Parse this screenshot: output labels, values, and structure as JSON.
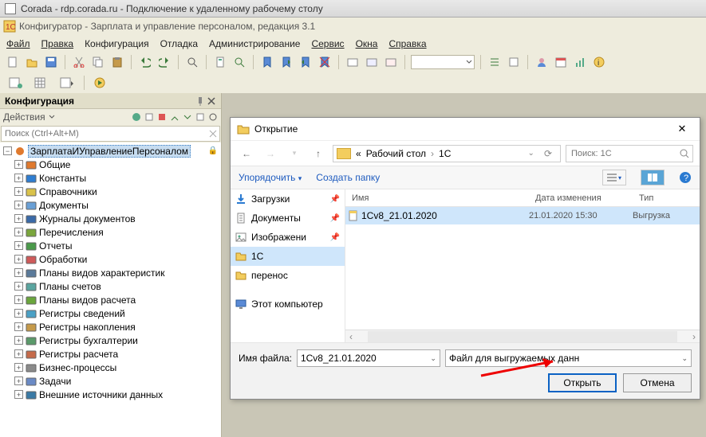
{
  "remote_title": "Corada - rdp.corada.ru - Подключение к удаленному рабочему столу",
  "app_title": "Конфигуратор - Зарплата и управление персоналом, редакция 3.1",
  "menu": [
    "Файл",
    "Правка",
    "Конфигурация",
    "Отладка",
    "Администрирование",
    "Сервис",
    "Окна",
    "Справка"
  ],
  "sidebar": {
    "title": "Конфигурация",
    "actions_label": "Действия",
    "search_placeholder": "Поиск (Ctrl+Alt+M)",
    "root": "ЗарплатаИУправлениеПерсоналом",
    "items": [
      {
        "label": "Общие",
        "color": "#e07a2e"
      },
      {
        "label": "Константы",
        "color": "#2e7dd1"
      },
      {
        "label": "Справочники",
        "color": "#d9c24a"
      },
      {
        "label": "Документы",
        "color": "#6aa0d6"
      },
      {
        "label": "Журналы документов",
        "color": "#3a6aa8"
      },
      {
        "label": "Перечисления",
        "color": "#7aa63c"
      },
      {
        "label": "Отчеты",
        "color": "#4a9a4a"
      },
      {
        "label": "Обработки",
        "color": "#cf5a5a"
      },
      {
        "label": "Планы видов характеристик",
        "color": "#5a7a9a"
      },
      {
        "label": "Планы счетов",
        "color": "#5aa5a0"
      },
      {
        "label": "Планы видов расчета",
        "color": "#6aa63c"
      },
      {
        "label": "Регистры сведений",
        "color": "#4aa0c5"
      },
      {
        "label": "Регистры накопления",
        "color": "#c59a4a"
      },
      {
        "label": "Регистры бухгалтерии",
        "color": "#5a9a6a"
      },
      {
        "label": "Регистры расчета",
        "color": "#c56a4a"
      },
      {
        "label": "Бизнес-процессы",
        "color": "#8a8a8a"
      },
      {
        "label": "Задачи",
        "color": "#6a8ac5"
      },
      {
        "label": "Внешние источники данных",
        "color": "#3a7aa5"
      }
    ]
  },
  "dialog": {
    "title": "Открытие",
    "breadcrumb_prefix": "«",
    "breadcrumb": [
      "Рабочий стол",
      "1C"
    ],
    "search_placeholder": "Поиск: 1C",
    "toolbar": {
      "organize": "Упорядочить",
      "new_folder": "Создать папку"
    },
    "left_items": [
      {
        "label": "Загрузки",
        "icon": "download",
        "pin": true
      },
      {
        "label": "Документы",
        "icon": "doc",
        "pin": true
      },
      {
        "label": "Изображени",
        "icon": "image",
        "pin": true
      },
      {
        "label": "1C",
        "icon": "folder",
        "selected": true
      },
      {
        "label": "перенос",
        "icon": "folder"
      },
      {
        "label": "Этот компьютер",
        "icon": "pc",
        "spacer": true
      }
    ],
    "columns": {
      "name": "Имя",
      "date": "Дата изменения",
      "type": "Тип"
    },
    "file": {
      "name": "1Cv8_21.01.2020",
      "date": "21.01.2020 15:30",
      "type": "Выгрузка"
    },
    "filename_label": "Имя файла:",
    "filename_value": "1Cv8_21.01.2020",
    "filetype_label": "Файл для выгружаемых данн",
    "open_btn": "Открыть",
    "cancel_btn": "Отмена"
  }
}
